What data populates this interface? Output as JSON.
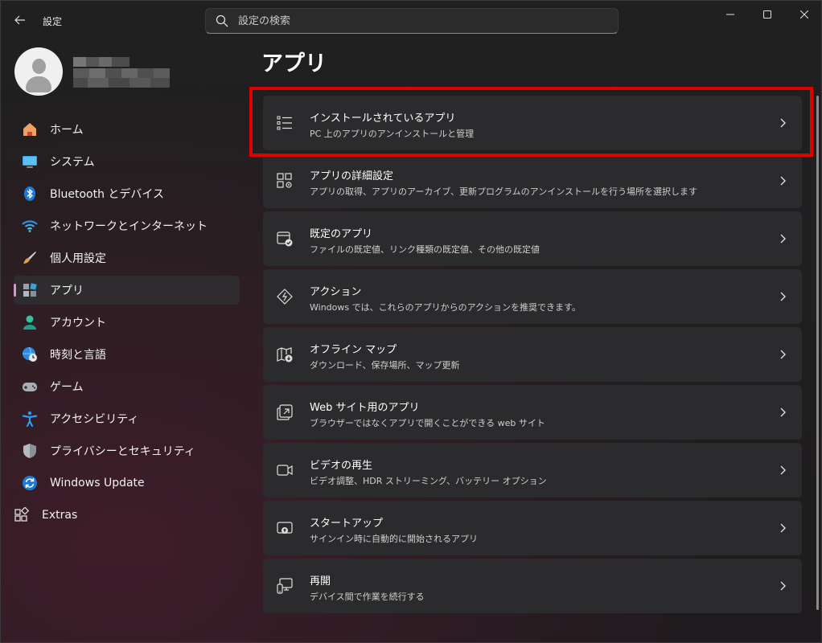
{
  "window": {
    "title": "設定"
  },
  "search": {
    "placeholder": "設定の検索"
  },
  "nav": {
    "items": [
      {
        "label": "ホーム",
        "icon": "home-icon"
      },
      {
        "label": "システム",
        "icon": "monitor-icon"
      },
      {
        "label": "Bluetooth とデバイス",
        "icon": "bluetooth-icon"
      },
      {
        "label": "ネットワークとインターネット",
        "icon": "wifi-icon"
      },
      {
        "label": "個人用設定",
        "icon": "brush-icon"
      },
      {
        "label": "アプリ",
        "icon": "apps-icon",
        "active": true
      },
      {
        "label": "アカウント",
        "icon": "account-icon"
      },
      {
        "label": "時刻と言語",
        "icon": "globe-clock-icon"
      },
      {
        "label": "ゲーム",
        "icon": "gamepad-icon"
      },
      {
        "label": "アクセシビリティ",
        "icon": "accessibility-icon"
      },
      {
        "label": "プライバシーとセキュリティ",
        "icon": "shield-icon"
      },
      {
        "label": "Windows Update",
        "icon": "update-icon"
      },
      {
        "label": "Extras",
        "icon": "extras-icon"
      }
    ]
  },
  "main": {
    "title": "アプリ",
    "cards": [
      {
        "title": "インストールされているアプリ",
        "subtitle": "PC 上のアプリのアンインストールと管理",
        "icon": "list-icon"
      },
      {
        "title": "アプリの詳細設定",
        "subtitle": "アプリの取得、アプリのアーカイブ、更新プログラムのアンインストールを行う場所を選択します",
        "icon": "app-settings-icon"
      },
      {
        "title": "既定のアプリ",
        "subtitle": "ファイルの既定値、リンク種類の既定値、その他の既定値",
        "icon": "default-apps-icon"
      },
      {
        "title": "アクション",
        "subtitle": "Windows では、これらのアプリからのアクションを推奨できます。",
        "icon": "action-icon"
      },
      {
        "title": "オフライン マップ",
        "subtitle": "ダウンロード、保存場所、マップ更新",
        "icon": "offline-map-icon"
      },
      {
        "title": "Web サイト用のアプリ",
        "subtitle": "ブラウザーではなくアプリで開くことができる web サイト",
        "icon": "open-in-app-icon"
      },
      {
        "title": "ビデオの再生",
        "subtitle": "ビデオ調整、HDR ストリーミング、バッテリー オプション",
        "icon": "video-icon"
      },
      {
        "title": "スタートアップ",
        "subtitle": "サインイン時に自動的に開始されるアプリ",
        "icon": "startup-icon"
      },
      {
        "title": "再開",
        "subtitle": "デバイス間で作業を続行する",
        "icon": "resume-icon"
      }
    ]
  },
  "colors": {
    "accent": "#e08ee0",
    "highlight": "#e00000"
  }
}
